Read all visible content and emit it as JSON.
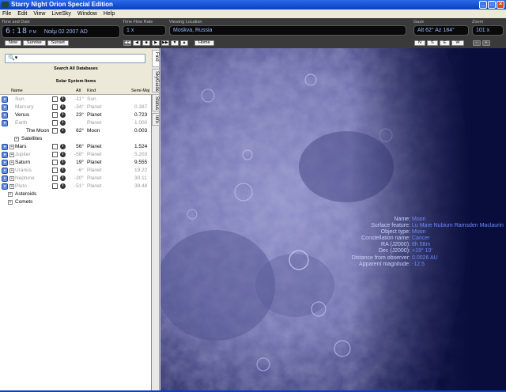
{
  "window": {
    "title": "Starry Night Orion Special Edition"
  },
  "menu": [
    "File",
    "Edit",
    "View",
    "LiveSky",
    "Window",
    "Help"
  ],
  "toolbar": {
    "time_label": "Time and Date",
    "time_value": "6:18",
    "ampm": "P M",
    "date_value": "Νοέμ 02 2007 AD",
    "now_label": "Now",
    "sunrise_label": "Sunrise",
    "sunset_label": "Sunset",
    "flow_label": "Time Flow Rate",
    "flow_value": "1 x",
    "location_label": "Viewing Location",
    "location_value": "Moskva, Russia",
    "home_label": "Home",
    "gaze_label": "Gaze",
    "gaze_value": "Alt 62° Az 184°",
    "compass": [
      "N",
      "S",
      "E",
      "W"
    ],
    "zoom_label": "Zoom",
    "zoom_value": "101 x"
  },
  "sidebar": {
    "search_placeholder": "",
    "search_sub": "Search All Databases",
    "section_title": "Solar System Items",
    "columns": {
      "name": "Name",
      "alt": "Alt",
      "kind": "Kind",
      "semi": "Semi-Maj"
    },
    "rows": [
      {
        "name": "Sun",
        "alt": "-11°",
        "kind": "Sun",
        "semi": "",
        "dim": true,
        "level": 0,
        "toggle": "expand"
      },
      {
        "name": "Mercury",
        "alt": "-34°",
        "kind": "Planet",
        "semi": "0.387",
        "dim": true,
        "level": 0,
        "toggle": "expand"
      },
      {
        "name": "Venus",
        "alt": "23°",
        "kind": "Planet",
        "semi": "0.723",
        "dim": false,
        "level": 0,
        "toggle": "expand"
      },
      {
        "name": "Earth",
        "alt": "",
        "kind": "Planet",
        "semi": "1.000",
        "dim": true,
        "level": 0,
        "toggle": "expand"
      },
      {
        "name": "The Moon",
        "alt": "62°",
        "kind": "Moon",
        "semi": "0.003",
        "dim": false,
        "level": 1,
        "toggle": "none"
      },
      {
        "name": "Satellites",
        "alt": "",
        "kind": "",
        "semi": "",
        "dim": false,
        "level": 1,
        "toggle": "plus"
      },
      {
        "name": "Mars",
        "alt": "56°",
        "kind": "Planet",
        "semi": "1.524",
        "dim": false,
        "level": 0,
        "toggle": "expand-plus"
      },
      {
        "name": "Jupiter",
        "alt": "-58°",
        "kind": "Planet",
        "semi": "5.203",
        "dim": true,
        "level": 0,
        "toggle": "expand-plus"
      },
      {
        "name": "Saturn",
        "alt": "19°",
        "kind": "Planet",
        "semi": "9.555",
        "dim": false,
        "level": 0,
        "toggle": "expand-plus"
      },
      {
        "name": "Uranus",
        "alt": "-6°",
        "kind": "Planet",
        "semi": "19.22",
        "dim": true,
        "level": 0,
        "toggle": "expand-plus"
      },
      {
        "name": "Neptune",
        "alt": "-30°",
        "kind": "Planet",
        "semi": "30.11",
        "dim": true,
        "level": 0,
        "toggle": "expand-plus"
      },
      {
        "name": "Pluto",
        "alt": "-51°",
        "kind": "Planet",
        "semi": "39.48",
        "dim": true,
        "level": 0,
        "toggle": "expand-plus"
      },
      {
        "name": "Asteroids",
        "alt": "",
        "kind": "",
        "semi": "",
        "dim": false,
        "level": 0,
        "toggle": "plus-only"
      },
      {
        "name": "Comets",
        "alt": "",
        "kind": "",
        "semi": "",
        "dim": false,
        "level": 0,
        "toggle": "plus-only"
      }
    ]
  },
  "side_tabs": [
    "Find",
    "SkyGuide",
    "Status",
    "Info"
  ],
  "overlay": [
    {
      "k": "Name:",
      "v": "Moon"
    },
    {
      "k": "Surface feature:",
      "v": "Lu Mare Nubium Ramsden Maclaurin"
    },
    {
      "k": "Object type:",
      "v": "Moon"
    },
    {
      "k": "Constellation name:",
      "v": "Cancer"
    },
    {
      "k": "RA (J2000):",
      "v": "8h 58m"
    },
    {
      "k": "Dec (J2000):",
      "v": "+19° 10'"
    },
    {
      "k": "Distance from observer:",
      "v": "0.0026 AU"
    },
    {
      "k": "Apparent magnitude:",
      "v": "-12.5"
    }
  ]
}
